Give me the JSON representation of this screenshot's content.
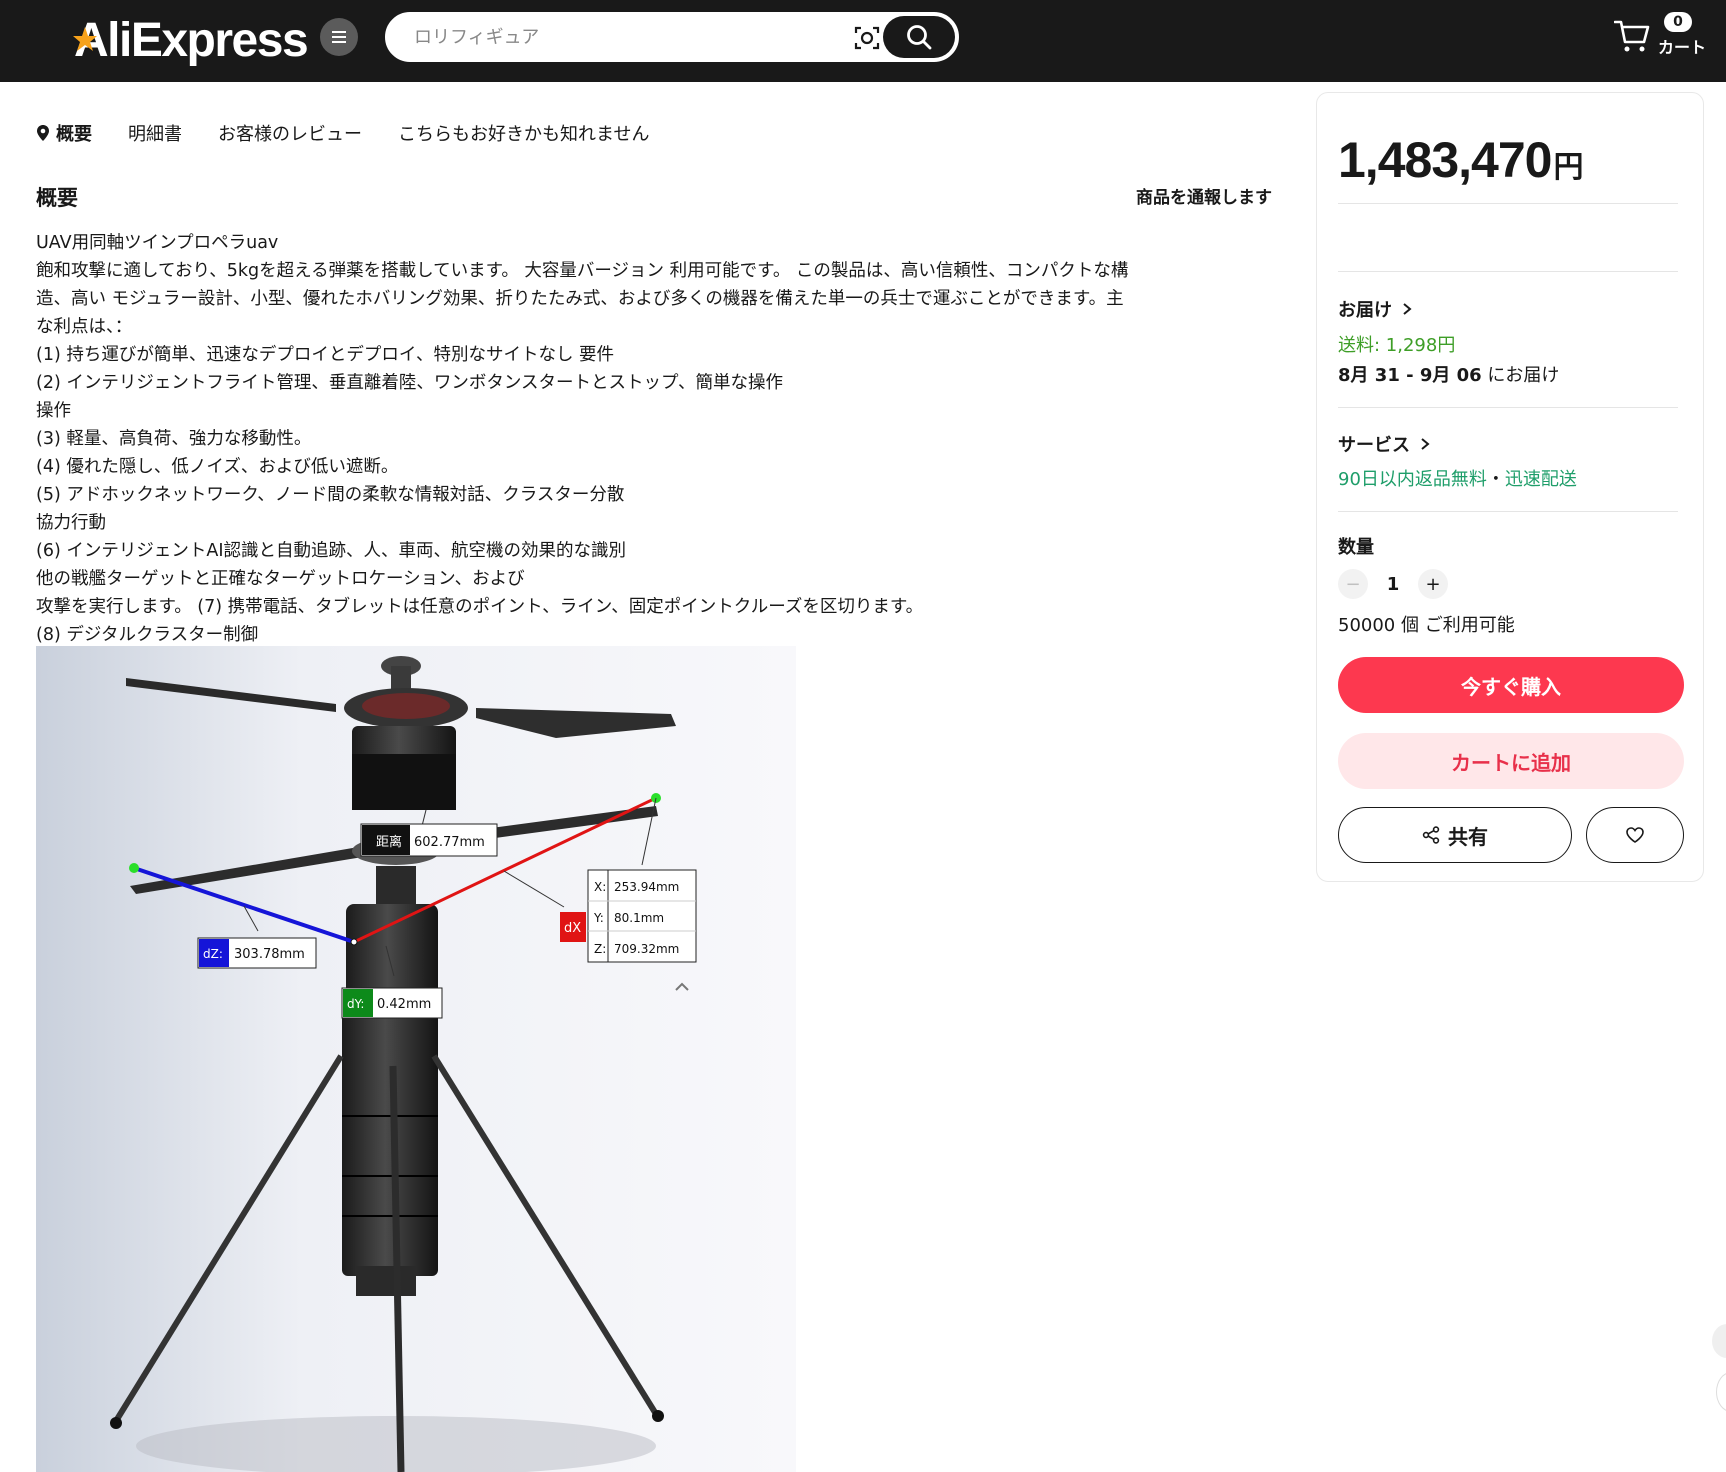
{
  "header": {
    "logo_text": "AliExpress",
    "search_placeholder": "ロリフィギュア",
    "cart_count": "0",
    "cart_label": "カート"
  },
  "tabs": [
    {
      "label": "概要",
      "active": true
    },
    {
      "label": "明細書"
    },
    {
      "label": "お客様のレビュー"
    },
    {
      "label": "こちらもお好きかも知れません"
    }
  ],
  "overview": {
    "title": "概要",
    "report_label": "商品を通報します",
    "lines": [
      "UAV用同軸ツインプロペラuav",
      "飽和攻撃に適しており、5kgを超える弾薬を搭載しています。 大容量バージョン 利用可能です。 この製品は、高い信頼性、コンパクトな構",
      "造、高い モジュラー設計、小型、優れたホバリング効果、折りたたみ式、および多くの機器を備えた単一の兵士で運ぶことができます。主",
      "な利点は、：",
      "(1) 持ち運びが簡単、迅速なデプロイとデプロイ、特別なサイトなし 要件",
      "(2) インテリジェントフライト管理、垂直離着陸、ワンボタンスタートとストップ、簡単な操作",
      "操作",
      "(3) 軽量、高負荷、強力な移動性。",
      "(4) 優れた隠し、低ノイズ、および低い遮断。",
      "(5) アドホックネットワーク、ノード間の柔軟な情報対話、クラスター分散",
      "協力行動",
      "(6) インテリジェントAI認識と自動追跡、人、車両、航空機の効果的な識別",
      "他の戦艦ターゲットと正確なターゲットロケーション、および",
      "攻撃を実行します。 (7) 携帯電話、タブレットは任意のポイント、ライン、固定ポイントクルーズを区切ります。",
      "(8) デジタルクラスター制御"
    ]
  },
  "image_labels": {
    "distance_tag": "距离",
    "distance": "602.77mm",
    "dx_tag": "dX",
    "x": "X:",
    "x_val": "253.94mm",
    "y": "Y:",
    "y_val": "80.1mm",
    "z": "Z:",
    "z_val": "709.32mm",
    "dz_tag": "dZ:",
    "dz_val": "303.78mm",
    "dy_tag": "dY:",
    "dy_val": "0.42mm"
  },
  "panel": {
    "price": "1,483,470",
    "currency": "円",
    "delivery_title": "お届け",
    "shipping_fee": "送料: 1,298円",
    "delivery_date_bold": "8月 31 - 9月 06",
    "delivery_date_suffix": " にお届け",
    "service_title": "サービス",
    "service_returns": "90日以内返品無料",
    "service_dot": "・",
    "service_fast": "迅速配送",
    "quantity_title": "数量",
    "quantity_value": "1",
    "stock": "50000 個 ご利用可能",
    "buy_now": "今すぐ購入",
    "add_to_cart": "カートに追加",
    "share": "共有"
  },
  "colors": {
    "header_bg": "#191919",
    "buy": "#fd384f",
    "add_to_cart_bg": "#ffe7e9",
    "shipping_green": "#3e9e27",
    "service_green": "#1f9e6a",
    "logo_star": "#f7a21b"
  },
  "icons": [
    "menu-icon",
    "image-search-icon",
    "search-icon",
    "cart-icon",
    "location-pin-icon",
    "chevron-right-icon",
    "share-icon",
    "heart-icon"
  ]
}
